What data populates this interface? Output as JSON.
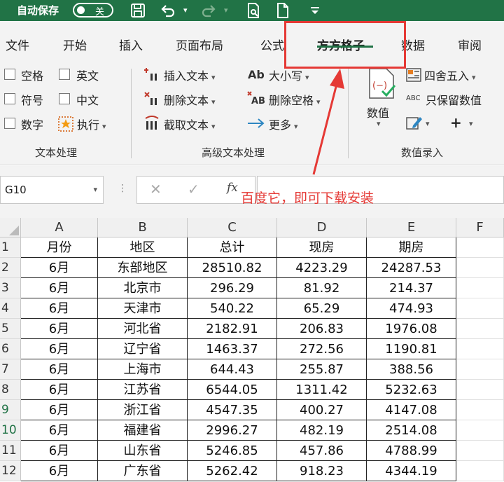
{
  "titlebar": {
    "autosave_label": "自动保存",
    "toggle_state": "关"
  },
  "tabs": [
    {
      "label": "文件"
    },
    {
      "label": "开始"
    },
    {
      "label": "插入"
    },
    {
      "label": "页面布局"
    },
    {
      "label": "公式"
    },
    {
      "label": "方方格子"
    },
    {
      "label": "数据"
    },
    {
      "label": "审阅"
    }
  ],
  "ribbon": {
    "text_group": {
      "items": [
        {
          "label": "空格"
        },
        {
          "label": "英文"
        },
        {
          "label": "符号"
        },
        {
          "label": "中文"
        },
        {
          "label": "数字"
        },
        {
          "label": "执行"
        }
      ],
      "group_label": "文本处理"
    },
    "advanced_group": {
      "items": [
        {
          "label": "插入文本"
        },
        {
          "label": "大小写"
        },
        {
          "label": "删除文本"
        },
        {
          "label": "删除空格"
        },
        {
          "label": "截取文本"
        },
        {
          "label": "更多"
        }
      ],
      "group_label": "高级文本处理"
    },
    "value_group": {
      "value_label": "数值",
      "round_label": "四舍五入",
      "keep_value_label": "只保留数值",
      "group_label": "数值录入"
    }
  },
  "formula_bar": {
    "name_box": "G10",
    "fx_label": "fx"
  },
  "annotation": "百度它，即可下载安装",
  "sheet": {
    "columns": [
      "A",
      "B",
      "C",
      "D",
      "E",
      "F"
    ],
    "rows": [
      "1",
      "2",
      "3",
      "4",
      "5",
      "6",
      "7",
      "8",
      "9",
      "10",
      "11",
      "12"
    ],
    "data": [
      [
        "月份",
        "地区",
        "总计",
        "现房",
        "期房"
      ],
      [
        "6月",
        "东部地区",
        "28510.82",
        "4223.29",
        "24287.53"
      ],
      [
        "6月",
        "北京市",
        "296.29",
        "81.92",
        "214.37"
      ],
      [
        "6月",
        "天津市",
        "540.22",
        "65.29",
        "474.93"
      ],
      [
        "6月",
        "河北省",
        "2182.91",
        "206.83",
        "1976.08"
      ],
      [
        "6月",
        "辽宁省",
        "1463.37",
        "272.56",
        "1190.81"
      ],
      [
        "6月",
        "上海市",
        "644.43",
        "255.87",
        "388.56"
      ],
      [
        "6月",
        "江苏省",
        "6544.05",
        "1311.42",
        "5232.63"
      ],
      [
        "6月",
        "浙江省",
        "4547.35",
        "400.27",
        "4147.08"
      ],
      [
        "6月",
        "福建省",
        "2996.27",
        "482.19",
        "2514.08"
      ],
      [
        "6月",
        "山东省",
        "5246.85",
        "457.86",
        "4788.99"
      ],
      [
        "6月",
        "广东省",
        "5262.42",
        "918.23",
        "4344.19"
      ]
    ]
  },
  "colors": {
    "titlebar": "#217346",
    "highlight": "#e53935",
    "annotation": "#e53935"
  }
}
